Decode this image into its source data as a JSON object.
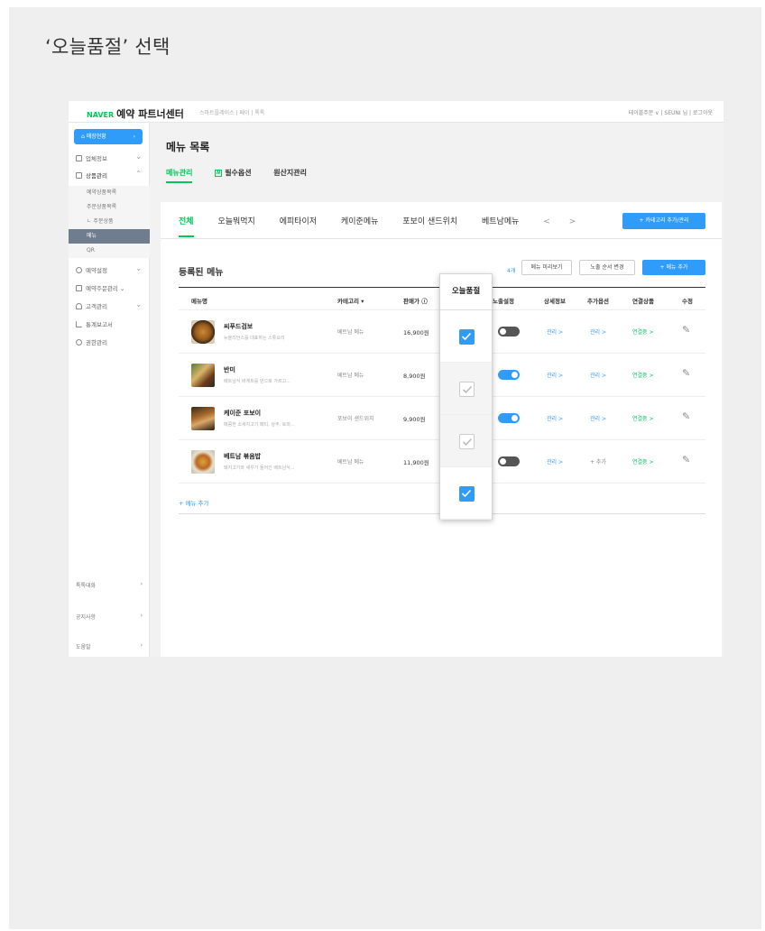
{
  "caption": "‘오늘품절’ 선택",
  "gnb": {
    "logo_naver": "NAVER",
    "logo_title": "예약 파트너센터",
    "services": "스마트플레이스 | 페이 | 톡톡",
    "right": "테이블주문 ∨ | SEUNI 님 | 로그아웃"
  },
  "lnb": {
    "home": "매장현황",
    "items": [
      "업체정보",
      "상품관리"
    ],
    "subs": [
      "예약상품목록",
      "주문상품목록",
      "ㄴ 주문상품",
      "메뉴",
      "QR"
    ],
    "items2": [
      "예약설정",
      "예약주문관리",
      "고객관리",
      "통계보고서",
      "권한관리"
    ],
    "bottom": [
      "톡톡대화",
      "공지사항",
      "도움말"
    ]
  },
  "page": {
    "title": "메뉴 목록",
    "tabs": [
      "메뉴관리",
      "필수옵션",
      "원산지관리"
    ],
    "required_badge": "N"
  },
  "categories": {
    "tabs": [
      "전체",
      "오늘뭐먹지",
      "에피타이저",
      "케이준메뉴",
      "포보이 샌드위치",
      "베트남메뉴"
    ],
    "prev": "<",
    "next": ">",
    "manage_button": "+ 카테고리 추가/관리"
  },
  "list": {
    "title": "등록된 메뉴",
    "count": "4개",
    "preview_button": "메뉴 미리보기",
    "order_button": "노출 순서 변경",
    "add_button": "+ 메뉴 추가",
    "headers": {
      "name": "메뉴명",
      "category": "카테고리 ▾",
      "price": "판매가 ⓘ",
      "display": "노출설정",
      "detail": "상세정보",
      "options": "추가옵션",
      "linked": "연결상품",
      "edit": "수정"
    },
    "rows": [
      {
        "name": "씨푸드검보",
        "desc": "뉴올리언스를 대표하는 스튜요리",
        "category": "베트남 메뉴",
        "price": "16,900원",
        "display_on": false,
        "detail": "관리 >",
        "options": "관리 >",
        "linked": "연결중 >"
      },
      {
        "name": "반미",
        "desc": "베트남식 바게트를 반으로 가르고...",
        "category": "베트남 메뉴",
        "price": "8,900원",
        "display_on": true,
        "detail": "관리 >",
        "options": "관리 >",
        "linked": "연결중 >"
      },
      {
        "name": "케이준 포보이",
        "desc": "매콤한 소세지고기 패티, 상추, 토마...",
        "category": "포보이 샌드위치",
        "price": "9,900원",
        "display_on": true,
        "detail": "관리 >",
        "options": "관리 >",
        "linked": "연결중 >"
      },
      {
        "name": "베트남 볶음밥",
        "desc": "돼지고기와 새우가 들어간 베트남식...",
        "category": "베트남 메뉴",
        "price": "11,900원",
        "display_on": false,
        "detail": "관리 >",
        "options": "+ 추가",
        "linked": "연결중 >"
      }
    ],
    "add_menu_link": "+ 메뉴 추가"
  },
  "soldout": {
    "header": "오늘품절",
    "checks": [
      "checked",
      "disabled",
      "disabled",
      "checked"
    ]
  },
  "colors": {
    "accent_green": "#03c75a",
    "accent_blue": "#2f9cf9"
  }
}
